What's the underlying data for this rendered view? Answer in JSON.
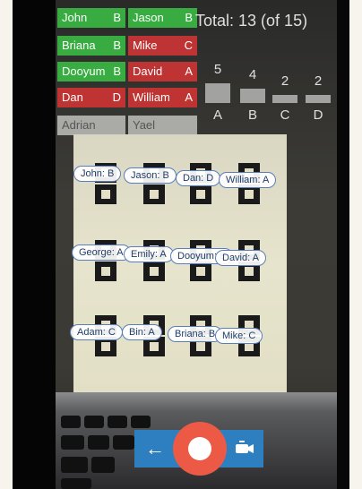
{
  "roster": {
    "col1": [
      {
        "name": "John",
        "grade": "B",
        "status": "green"
      },
      {
        "name": "Briana",
        "grade": "B",
        "status": "green"
      },
      {
        "name": "Dooyum",
        "grade": "B",
        "status": "green"
      },
      {
        "name": "Dan",
        "grade": "D",
        "status": "red"
      },
      {
        "name": "Adrian",
        "grade": "",
        "status": "grey"
      }
    ],
    "col2": [
      {
        "name": "Jason",
        "grade": "B",
        "status": "green"
      },
      {
        "name": "Mike",
        "grade": "C",
        "status": "red"
      },
      {
        "name": "David",
        "grade": "A",
        "status": "red"
      },
      {
        "name": "William",
        "grade": "A",
        "status": "red"
      },
      {
        "name": "Yael",
        "grade": "",
        "status": "grey"
      }
    ]
  },
  "summary": {
    "total_label": "Total: 13 (of 15)",
    "bars": [
      {
        "label": "A",
        "count": "5"
      },
      {
        "label": "B",
        "count": "4"
      },
      {
        "label": "C",
        "count": "2"
      },
      {
        "label": "D",
        "count": "2"
      }
    ]
  },
  "scan_tags": [
    "John: B",
    "Jason: B",
    "Dan: D",
    "William: A",
    "George: A",
    "Emily: A",
    "Dooyum: B",
    "David: A",
    "Adam: C",
    "Bin: A",
    "Briana: B",
    "Mike: C"
  ],
  "controls": {
    "back_icon": "arrow-left-icon",
    "record_icon": "record-icon",
    "switch_icon": "switch-camera-icon"
  },
  "colors": {
    "green": "#3abe44",
    "red": "#d63434",
    "record": "#ec5a46",
    "toolbar": "#2e7fbf"
  }
}
